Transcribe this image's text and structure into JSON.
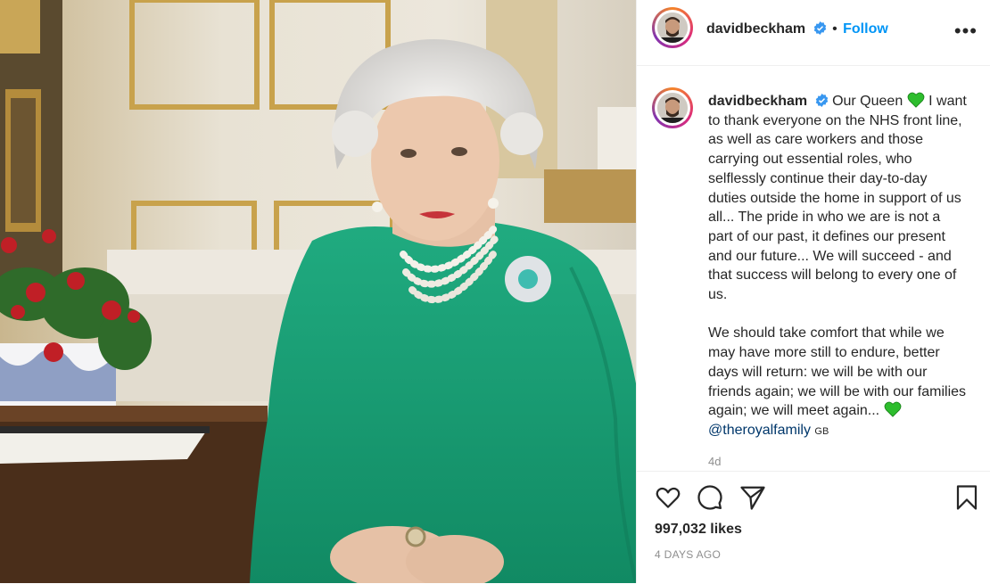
{
  "post": {
    "username": "davidbeckham",
    "follow_label": "Follow",
    "separator": "•",
    "more_label": "•••",
    "caption_intro": "Our Queen",
    "caption_p1": "I want to thank everyone on the NHS front line, as well as care workers and those carrying out essential roles, who selflessly continue their day-to-day duties outside the home in support of us all... The pride in who we are is not a part of our past, it defines our present and our future... We will succeed - and that success will belong to every one of us.",
    "caption_p2": "We should take comfort that while we may have more still to endure, better days will return: we will be with our friends again; we will be with our families again; we will meet again...",
    "mention": "@theroyalfamily",
    "mention_suffix": "GB",
    "age": "4d",
    "likes": "997,032 likes",
    "date": "4 DAYS AGO"
  },
  "colors": {
    "accent": "#0095f6",
    "heart_green": "#2dbd2d",
    "dress_green": "#1aa278"
  },
  "icons": [
    "heart-icon",
    "comment-icon",
    "share-icon",
    "bookmark-icon",
    "verified-icon",
    "more-icon",
    "green-heart-emoji"
  ]
}
